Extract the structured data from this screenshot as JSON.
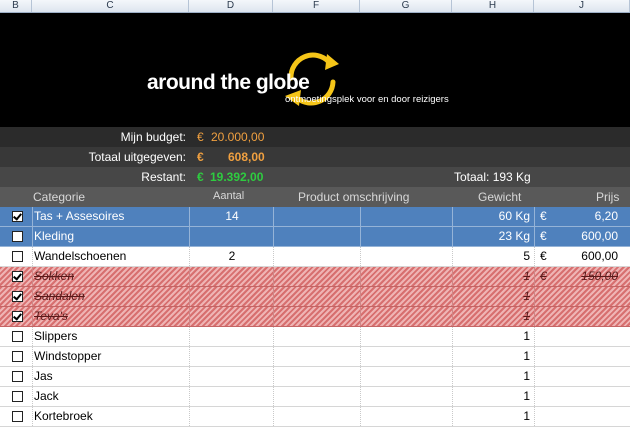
{
  "columns": [
    "B",
    "C",
    "D",
    "F",
    "G",
    "H",
    "J"
  ],
  "banner": {
    "title": "around the globe",
    "subtitle": "ontmoetingsplek voor en door reizigers",
    "accent": "#f5c518"
  },
  "summary": {
    "budget_label": "Mijn budget:",
    "budget_currency": "€",
    "budget_value": "20.000,00",
    "spent_label": "Totaal uitgegeven:",
    "spent_currency": "€",
    "spent_value": "608,00",
    "remaining_label": "Restant:",
    "remaining_currency": "€",
    "remaining_value": "19.392,00",
    "total_weight": "Totaal: 193 Kg"
  },
  "headers": {
    "category": "Categorie",
    "amount": "Aantal",
    "description": "Product omschrijving",
    "weight": "Gewicht",
    "price": "Prijs"
  },
  "rows": [
    {
      "checked": true,
      "style": "blue",
      "category": "Tas + Assesoires",
      "amount": "14",
      "weight": "60 Kg",
      "currency": "€",
      "price": "6,20"
    },
    {
      "checked": false,
      "style": "blue",
      "category": "Kleding",
      "amount": "",
      "weight": "23 Kg",
      "currency": "€",
      "price": "600,00"
    },
    {
      "checked": false,
      "style": "plain",
      "category": "Wandelschoenen",
      "amount": "2",
      "weight": "5",
      "currency": "€",
      "price": "600,00"
    },
    {
      "checked": true,
      "style": "red",
      "category": "Sokken",
      "amount": "",
      "weight": "1",
      "currency": "€",
      "price": "150,00"
    },
    {
      "checked": true,
      "style": "red",
      "category": "Sandalen",
      "amount": "",
      "weight": "1",
      "currency": "",
      "price": ""
    },
    {
      "checked": true,
      "style": "red",
      "category": "Teva's",
      "amount": "",
      "weight": "1",
      "currency": "",
      "price": ""
    },
    {
      "checked": false,
      "style": "plain",
      "category": "Slippers",
      "amount": "",
      "weight": "1",
      "currency": "",
      "price": ""
    },
    {
      "checked": false,
      "style": "plain",
      "category": "Windstopper",
      "amount": "",
      "weight": "1",
      "currency": "",
      "price": ""
    },
    {
      "checked": false,
      "style": "plain",
      "category": "Jas",
      "amount": "",
      "weight": "1",
      "currency": "",
      "price": ""
    },
    {
      "checked": false,
      "style": "plain",
      "category": "Jack",
      "amount": "",
      "weight": "1",
      "currency": "",
      "price": ""
    },
    {
      "checked": false,
      "style": "plain",
      "category": "Kortebroek",
      "amount": "",
      "weight": "1",
      "currency": "",
      "price": ""
    }
  ]
}
